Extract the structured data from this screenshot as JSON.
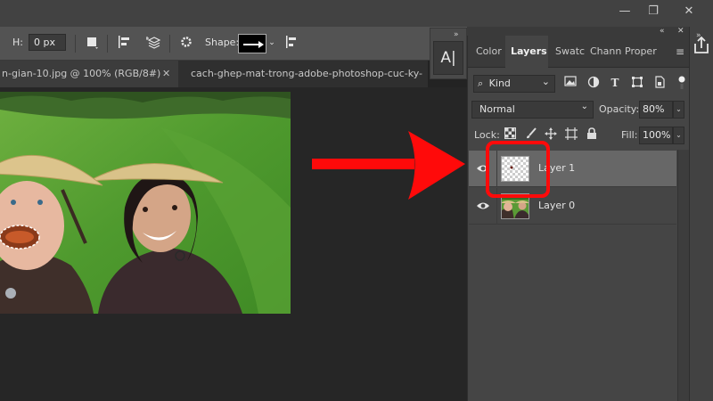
{
  "window": {
    "minimize_glyph": "—",
    "restore_glyph": "❐",
    "close_glyph": "✕"
  },
  "options_bar": {
    "h_label": "H:",
    "h_value": "0 px",
    "shape_label": "Shape:",
    "shape_value": "arrow",
    "icons": [
      "fill-square-icon",
      "align-icon",
      "arrange-icon",
      "gear-icon",
      "chevron-down-icon",
      "align-edges-icon"
    ]
  },
  "document_tabs": [
    {
      "label": "n-gian-10.jpg @ 100% (RGB/8#)",
      "close": "✕",
      "active": true
    },
    {
      "label": "cach-ghep-mat-trong-adobe-photoshop-cuc-ky-",
      "active": false
    }
  ],
  "mini_panel": {
    "collapse_glyph": "»",
    "character_label": "A|"
  },
  "layers_panel": {
    "collapse_glyph": "«",
    "close_glyph": "✕",
    "expand_glyph": "»",
    "tabs": [
      "Color",
      "Layers",
      "Swatc",
      "Chann",
      "Proper"
    ],
    "active_tab": "Layers",
    "menu_glyph": "≡",
    "filter": {
      "kind_label": "Kind",
      "search_glyph": "⌕",
      "chevron": "⌄"
    },
    "filter_icons": [
      "image-filter-icon",
      "adjustment-filter-icon",
      "type-filter-icon",
      "shape-filter-icon",
      "smart-object-filter-icon",
      "toggle-filter-icon"
    ],
    "blend_mode": "Normal",
    "opacity_label": "Opacity:",
    "opacity_value": "80%",
    "lock_label": "Lock:",
    "fill_label": "Fill:",
    "fill_value": "100%",
    "layers": [
      {
        "name": "Layer 1",
        "selected": true,
        "visible": true
      },
      {
        "name": "Layer 0",
        "selected": false,
        "visible": true
      }
    ]
  },
  "annotation": {
    "arrow_color": "#ff0a0a",
    "highlight_color": "#ff0a0a"
  }
}
